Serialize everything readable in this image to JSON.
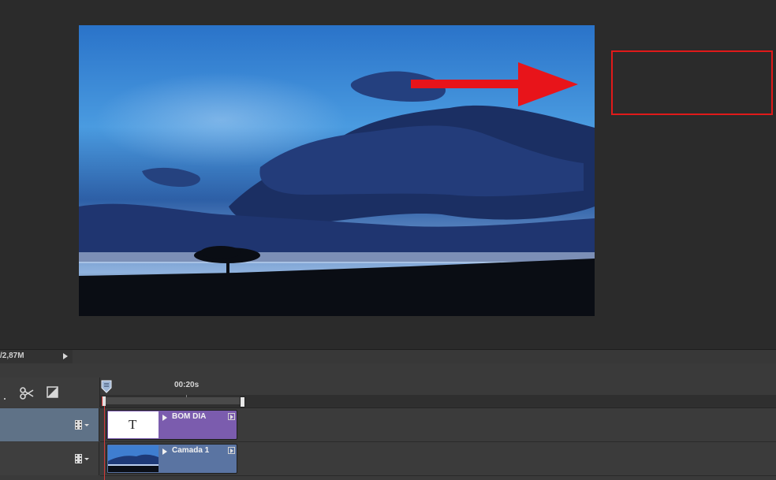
{
  "status_bar": {
    "doc_size": "/2,87M"
  },
  "timeline": {
    "time_label": "00:20s",
    "tracks": [
      {
        "clip_label": "BOM DIA",
        "thumb_glyph": "T",
        "clip_color": "#7b5cae"
      },
      {
        "clip_label": "Camada 1",
        "clip_color": "#5a74a2"
      }
    ],
    "tools": [
      "scissors-icon",
      "transition-icon"
    ]
  },
  "annotation": {
    "arrow_color": "#e8141a",
    "highlight_color": "#e01a1a"
  },
  "colors": {
    "canvas_bg": "#2b2b2b",
    "selected_track_header": "#5f7287",
    "playhead": "#d43a3a"
  }
}
